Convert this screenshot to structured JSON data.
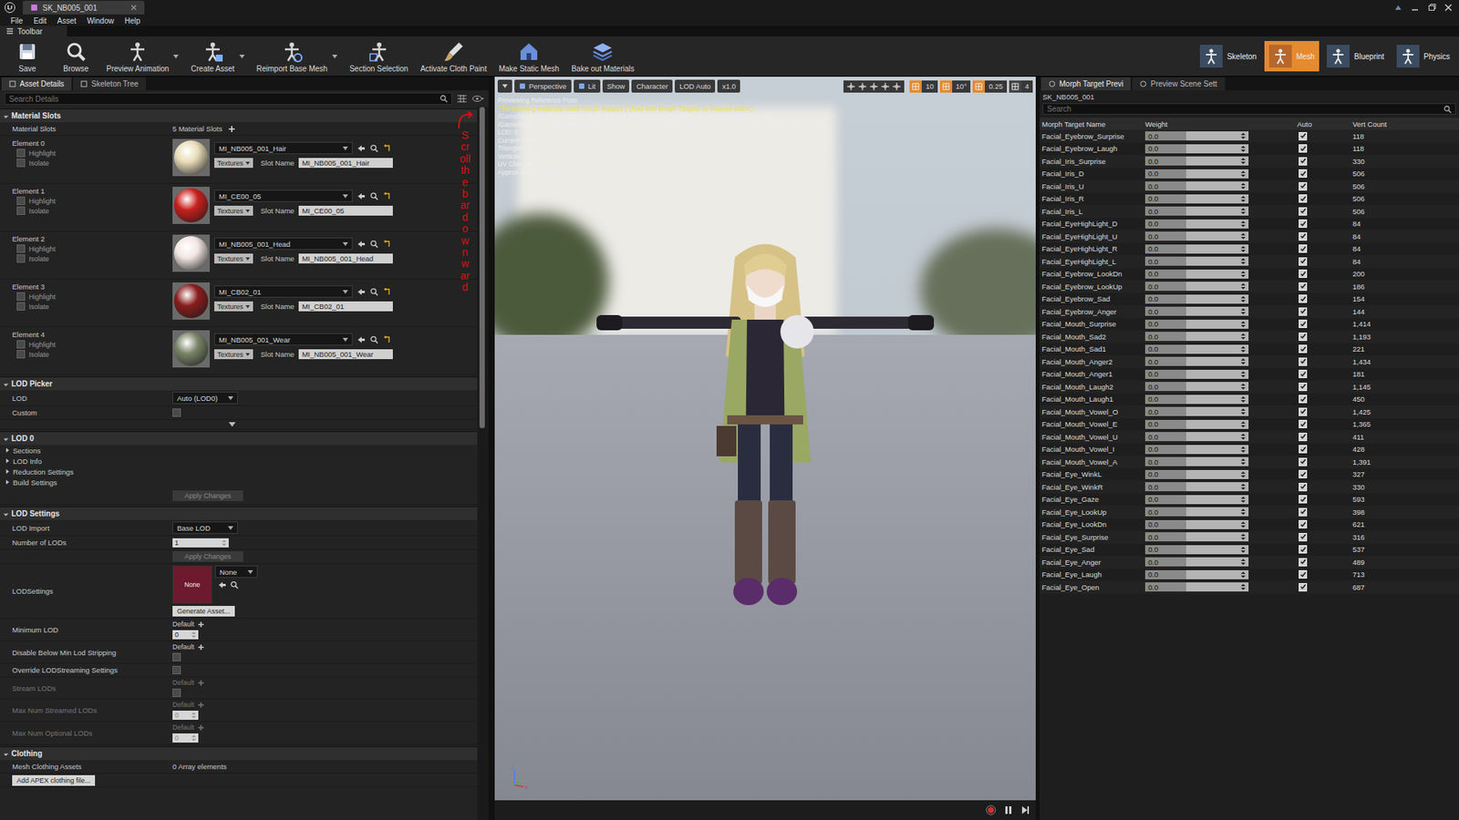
{
  "window": {
    "tab": "SK_NB005_001"
  },
  "menu": [
    "File",
    "Edit",
    "Asset",
    "Window",
    "Help"
  ],
  "toolbar": {
    "label": "Toolbar",
    "buttons": [
      {
        "label": "Save",
        "dropdown": false
      },
      {
        "label": "Browse",
        "dropdown": false
      },
      {
        "label": "Preview Animation",
        "dropdown": true
      },
      {
        "label": "Create Asset",
        "dropdown": true
      },
      {
        "label": "Reimport Base Mesh",
        "dropdown": true
      },
      {
        "label": "Section Selection",
        "dropdown": false
      },
      {
        "label": "Activate Cloth Paint",
        "dropdown": false
      },
      {
        "label": "Make Static Mesh",
        "dropdown": false
      },
      {
        "label": "Bake out Materials",
        "dropdown": false
      }
    ]
  },
  "modes": [
    {
      "label": "Skeleton",
      "selected": false
    },
    {
      "label": "Mesh",
      "selected": true
    },
    {
      "label": "Blueprint",
      "selected": false
    },
    {
      "label": "Physics",
      "selected": false
    }
  ],
  "left_panel": {
    "tabs": [
      {
        "label": "Asset Details",
        "selected": true
      },
      {
        "label": "Skeleton Tree",
        "selected": false
      }
    ],
    "search": {
      "placeholder": "Search Details"
    },
    "scrollbar": {
      "level": 0.45
    },
    "material_slots": {
      "title": "Material Slots",
      "expanded": true,
      "label": "Material Slots",
      "count": "5 Material Slots",
      "elements": [
        {
          "label": "Element 0",
          "material": "MI_NB005_001_Hair",
          "textures": "Textures",
          "slot_label": "Slot Name",
          "slot_name": "MI_NB005_001_Hair",
          "highlight_label": "Highlight",
          "highlight": false,
          "isolate_label": "Isolate",
          "isolate": false,
          "color": "#e8dcb8"
        },
        {
          "label": "Element 1",
          "material": "MI_CE00_05",
          "textures": "Textures",
          "slot_label": "Slot Name",
          "slot_name": "MI_CE00_05",
          "highlight_label": "Highlight",
          "highlight": false,
          "isolate_label": "Isolate",
          "isolate": false,
          "color": "#c8201c"
        },
        {
          "label": "Element 2",
          "material": "MI_NB005_001_Head",
          "textures": "Textures",
          "slot_label": "Slot Name",
          "slot_name": "MI_NB005_001_Head",
          "highlight_label": "Highlight",
          "highlight": false,
          "isolate_label": "Isolate",
          "isolate": false,
          "color": "#f2e6e2"
        },
        {
          "label": "Element 3",
          "material": "MI_CB02_01",
          "textures": "Textures",
          "slot_label": "Slot Name",
          "slot_name": "MI_CB02_01",
          "highlight_label": "Highlight",
          "highlight": false,
          "isolate_label": "Isolate",
          "isolate": false,
          "color": "#8a1c1c"
        },
        {
          "label": "Element 4",
          "material": "MI_NB005_001_Wear",
          "textures": "Textures",
          "slot_label": "Slot Name",
          "slot_name": "MI_NB005_001_Wear",
          "highlight_label": "Highlight",
          "highlight": false,
          "isolate_label": "Isolate",
          "isolate": false,
          "color": "#7a8468"
        }
      ]
    },
    "lod_picker": {
      "title": "LOD Picker",
      "expanded": true,
      "lod_label": "LOD",
      "lod_value": "Auto (LOD0)",
      "custom_label": "Custom",
      "custom": false
    },
    "lod0": {
      "title": "LOD 0",
      "expanded": true,
      "items": [
        {
          "label": "Sections",
          "expanded": false
        },
        {
          "label": "LOD Info",
          "expanded": false
        },
        {
          "label": "Reduction Settings",
          "expanded": false
        },
        {
          "label": "Build Settings",
          "expanded": false
        }
      ],
      "button": "Apply Changes",
      "button_disabled": true
    },
    "lod_settings": {
      "title": "LOD Settings",
      "expanded": true,
      "rows": [
        {
          "kind": "dropdown",
          "label": "LOD Import",
          "value": "Base LOD",
          "disabled": false
        },
        {
          "kind": "number",
          "label": "Number of LODs",
          "value": "1",
          "disabled": false
        },
        {
          "kind": "button",
          "label": "",
          "value": "Apply Changes",
          "disabled": true
        },
        {
          "kind": "asset",
          "label": "LODSettings",
          "thumb": "None",
          "value": "None",
          "button": "Generate Asset...",
          "disabled": false
        },
        {
          "kind": "default_number",
          "label": "Minimum LOD",
          "default": "Default",
          "value": "0",
          "disabled": false
        },
        {
          "kind": "default_check",
          "label": "Disable Below Min Lod Stripping",
          "default": "Default",
          "checked": false,
          "disabled": false
        },
        {
          "kind": "checkbox",
          "label": "Override LODStreaming Settings",
          "checked": false,
          "disabled": false
        },
        {
          "kind": "default_check",
          "label": "Stream LODs",
          "default": "Default",
          "checked": false,
          "disabled": true
        },
        {
          "kind": "default_number",
          "label": "Max Num Streamed LODs",
          "default": "Default",
          "value": "0",
          "disabled": true
        },
        {
          "kind": "default_number",
          "label": "Max Num Optional LODs",
          "default": "Default",
          "value": "0",
          "disabled": true
        }
      ]
    },
    "clothing": {
      "title": "Clothing",
      "expanded": true,
      "label": "Mesh Clothing Assets",
      "value": "0 Array elements",
      "button": "Add APEX clothing file..."
    }
  },
  "annotation": {
    "text": "Scroll the bar downward",
    "color": "#d41414"
  },
  "viewport": {
    "toolbar": [
      "Perspective",
      "Lit",
      "Show",
      "Character",
      "LOD Auto",
      "x1.0"
    ],
    "snaps": [
      {
        "value": "10",
        "on": true
      },
      {
        "value": "10°",
        "on": true
      },
      {
        "value": "0.25",
        "on": true
      },
      {
        "value": "4",
        "on": false
      }
    ],
    "info": {
      "pose": "Previewing Reference Pose",
      "warning": "The following materials need morph support ('Used with Morph Targets' in material editor):",
      "paths": [
        "/Game/Model/NormalCharacter/Body/NB008_001/Child/NB008_001/MI_CE00_05.MI_CE00_05",
        "/Game/Model/NormalCharacter/Body/NB008_001/Child/NB008_001/MI_NB005_001_Head.MI_NB005_001_Head"
      ],
      "stats": [
        "LOD: 0",
        "Current Screen Size: 1",
        "Triangles: 36,699",
        "Vertices: 28,812",
        "UV Channels: 1",
        "Approx Size: 145x56x165"
      ]
    },
    "axes": [
      "z",
      "x"
    ]
  },
  "right_panel": {
    "tabs": [
      {
        "label": "Morph Target Previ",
        "selected": true
      },
      {
        "label": "Preview Scene Sett",
        "selected": false
      }
    ],
    "asset": "SK_NB005_001",
    "search": {
      "placeholder": "Search"
    },
    "columns": [
      "Morph Target Name",
      "Weight",
      "Auto",
      "Vert Count"
    ],
    "rows": [
      {
        "name": "Facial_Eyebrow_Surprise",
        "weight": "0.0",
        "auto": true,
        "verts": "118"
      },
      {
        "name": "Facial_Eyebrow_Laugh",
        "weight": "0.0",
        "auto": true,
        "verts": "118"
      },
      {
        "name": "Facial_Iris_Surprise",
        "weight": "0.0",
        "auto": true,
        "verts": "330"
      },
      {
        "name": "Facial_Iris_D",
        "weight": "0.0",
        "auto": true,
        "verts": "506"
      },
      {
        "name": "Facial_Iris_U",
        "weight": "0.0",
        "auto": true,
        "verts": "506"
      },
      {
        "name": "Facial_Iris_R",
        "weight": "0.0",
        "auto": true,
        "verts": "506"
      },
      {
        "name": "Facial_Iris_L",
        "weight": "0.0",
        "auto": true,
        "verts": "506"
      },
      {
        "name": "Facial_EyeHighLight_D",
        "weight": "0.0",
        "auto": true,
        "verts": "84"
      },
      {
        "name": "Facial_EyeHighLight_U",
        "weight": "0.0",
        "auto": true,
        "verts": "84"
      },
      {
        "name": "Facial_EyeHighLight_R",
        "weight": "0.0",
        "auto": true,
        "verts": "84"
      },
      {
        "name": "Facial_EyeHighLight_L",
        "weight": "0.0",
        "auto": true,
        "verts": "84"
      },
      {
        "name": "Facial_Eyebrow_LookDn",
        "weight": "0.0",
        "auto": true,
        "verts": "200"
      },
      {
        "name": "Facial_Eyebrow_LookUp",
        "weight": "0.0",
        "auto": true,
        "verts": "186"
      },
      {
        "name": "Facial_Eyebrow_Sad",
        "weight": "0.0",
        "auto": true,
        "verts": "154"
      },
      {
        "name": "Facial_Eyebrow_Anger",
        "weight": "0.0",
        "auto": true,
        "verts": "144"
      },
      {
        "name": "Facial_Mouth_Surprise",
        "weight": "0.0",
        "auto": true,
        "verts": "1,414"
      },
      {
        "name": "Facial_Mouth_Sad2",
        "weight": "0.0",
        "auto": true,
        "verts": "1,193"
      },
      {
        "name": "Facial_Mouth_Sad1",
        "weight": "0.0",
        "auto": true,
        "verts": "221"
      },
      {
        "name": "Facial_Mouth_Anger2",
        "weight": "0.0",
        "auto": true,
        "verts": "1,434"
      },
      {
        "name": "Facial_Mouth_Anger1",
        "weight": "0.0",
        "auto": true,
        "verts": "181"
      },
      {
        "name": "Facial_Mouth_Laugh2",
        "weight": "0.0",
        "auto": true,
        "verts": "1,145"
      },
      {
        "name": "Facial_Mouth_Laugh1",
        "weight": "0.0",
        "auto": true,
        "verts": "450"
      },
      {
        "name": "Facial_Mouth_Vowel_O",
        "weight": "0.0",
        "auto": true,
        "verts": "1,425"
      },
      {
        "name": "Facial_Mouth_Vowel_E",
        "weight": "0.0",
        "auto": true,
        "verts": "1,365"
      },
      {
        "name": "Facial_Mouth_Vowel_U",
        "weight": "0.0",
        "auto": true,
        "verts": "411"
      },
      {
        "name": "Facial_Mouth_Vowel_I",
        "weight": "0.0",
        "auto": true,
        "verts": "428"
      },
      {
        "name": "Facial_Mouth_Vowel_A",
        "weight": "0.0",
        "auto": true,
        "verts": "1,391"
      },
      {
        "name": "Facial_Eye_WinkL",
        "weight": "0.0",
        "auto": true,
        "verts": "327"
      },
      {
        "name": "Facial_Eye_WinkR",
        "weight": "0.0",
        "auto": true,
        "verts": "330"
      },
      {
        "name": "Facial_Eye_Gaze",
        "weight": "0.0",
        "auto": true,
        "verts": "593"
      },
      {
        "name": "Facial_Eye_LookUp",
        "weight": "0.0",
        "auto": true,
        "verts": "398"
      },
      {
        "name": "Facial_Eye_LookDn",
        "weight": "0.0",
        "auto": true,
        "verts": "621"
      },
      {
        "name": "Facial_Eye_Surprise",
        "weight": "0.0",
        "auto": true,
        "verts": "316"
      },
      {
        "name": "Facial_Eye_Sad",
        "weight": "0.0",
        "auto": true,
        "verts": "537"
      },
      {
        "name": "Facial_Eye_Anger",
        "weight": "0.0",
        "auto": true,
        "verts": "489"
      },
      {
        "name": "Facial_Eye_Laugh",
        "weight": "0.0",
        "auto": true,
        "verts": "713"
      },
      {
        "name": "Facial_Eye_Open",
        "weight": "0.0",
        "auto": true,
        "verts": "687"
      }
    ]
  }
}
